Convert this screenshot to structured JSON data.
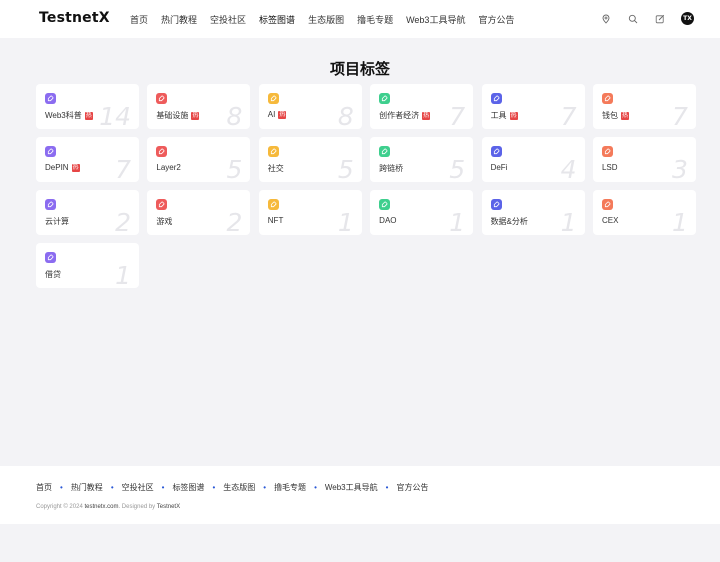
{
  "header": {
    "logo": "TestnetX",
    "nav": [
      "首页",
      "热门教程",
      "空投社区",
      "标签图谱",
      "生态版图",
      "撸毛专题",
      "Web3工具导航",
      "官方公告"
    ],
    "active_index": 3,
    "icons": [
      "location-icon",
      "search-icon",
      "edit-icon"
    ],
    "avatar_text": "TX"
  },
  "page_title": "项目标签",
  "hot_badge": "热",
  "tags": [
    {
      "name": "Web3科普",
      "count": "14",
      "hot": true,
      "color": "#8b6cf0"
    },
    {
      "name": "基础设施",
      "count": "8",
      "hot": true,
      "color": "#ee5b5b"
    },
    {
      "name": "AI",
      "count": "8",
      "hot": true,
      "color": "#f6b93b"
    },
    {
      "name": "创作者经济",
      "count": "7",
      "hot": true,
      "color": "#3ecf8e"
    },
    {
      "name": "工具",
      "count": "7",
      "hot": true,
      "color": "#5b63e8"
    },
    {
      "name": "钱包",
      "count": "7",
      "hot": true,
      "color": "#f47a5a"
    },
    {
      "name": "DePIN",
      "count": "7",
      "hot": true,
      "color": "#8b6cf0"
    },
    {
      "name": "Layer2",
      "count": "5",
      "hot": false,
      "color": "#ee5b5b"
    },
    {
      "name": "社交",
      "count": "5",
      "hot": false,
      "color": "#f6b93b"
    },
    {
      "name": "跨链桥",
      "count": "5",
      "hot": false,
      "color": "#3ecf8e"
    },
    {
      "name": "DeFi",
      "count": "4",
      "hot": false,
      "color": "#5b63e8"
    },
    {
      "name": "LSD",
      "count": "3",
      "hot": false,
      "color": "#f47a5a"
    },
    {
      "name": "云计算",
      "count": "2",
      "hot": false,
      "color": "#8b6cf0"
    },
    {
      "name": "游戏",
      "count": "2",
      "hot": false,
      "color": "#ee5b5b"
    },
    {
      "name": "NFT",
      "count": "1",
      "hot": false,
      "color": "#f6b93b"
    },
    {
      "name": "DAO",
      "count": "1",
      "hot": false,
      "color": "#3ecf8e"
    },
    {
      "name": "数据&分析",
      "count": "1",
      "hot": false,
      "color": "#5b63e8"
    },
    {
      "name": "CEX",
      "count": "1",
      "hot": false,
      "color": "#f47a5a"
    },
    {
      "name": "借贷",
      "count": "1",
      "hot": false,
      "color": "#8b6cf0"
    }
  ],
  "footer": {
    "links": [
      "首页",
      "热门教程",
      "空投社区",
      "标签图谱",
      "生态版图",
      "撸毛专题",
      "Web3工具导航",
      "官方公告"
    ],
    "copyright_prefix": "Copyright © 2024",
    "site": "testnetx.com",
    "designed_by_prefix": ". Designed by",
    "designer": "TestnetX"
  }
}
